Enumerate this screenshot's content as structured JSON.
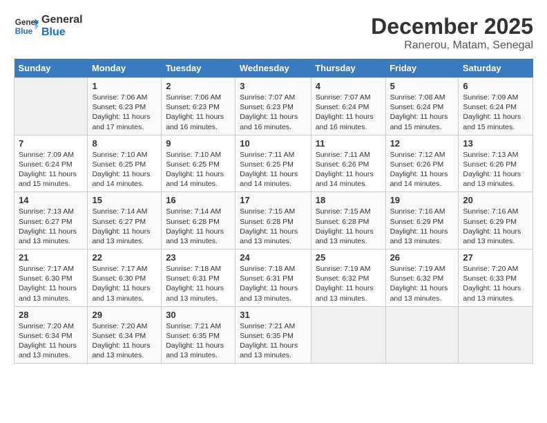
{
  "logo": {
    "text_general": "General",
    "text_blue": "Blue"
  },
  "title": "December 2025",
  "subtitle": "Ranerou, Matam, Senegal",
  "days_of_week": [
    "Sunday",
    "Monday",
    "Tuesday",
    "Wednesday",
    "Thursday",
    "Friday",
    "Saturday"
  ],
  "weeks": [
    [
      {
        "num": "",
        "info": ""
      },
      {
        "num": "1",
        "info": "Sunrise: 7:06 AM\nSunset: 6:23 PM\nDaylight: 11 hours\nand 17 minutes."
      },
      {
        "num": "2",
        "info": "Sunrise: 7:06 AM\nSunset: 6:23 PM\nDaylight: 11 hours\nand 16 minutes."
      },
      {
        "num": "3",
        "info": "Sunrise: 7:07 AM\nSunset: 6:23 PM\nDaylight: 11 hours\nand 16 minutes."
      },
      {
        "num": "4",
        "info": "Sunrise: 7:07 AM\nSunset: 6:24 PM\nDaylight: 11 hours\nand 16 minutes."
      },
      {
        "num": "5",
        "info": "Sunrise: 7:08 AM\nSunset: 6:24 PM\nDaylight: 11 hours\nand 15 minutes."
      },
      {
        "num": "6",
        "info": "Sunrise: 7:09 AM\nSunset: 6:24 PM\nDaylight: 11 hours\nand 15 minutes."
      }
    ],
    [
      {
        "num": "7",
        "info": "Sunrise: 7:09 AM\nSunset: 6:24 PM\nDaylight: 11 hours\nand 15 minutes."
      },
      {
        "num": "8",
        "info": "Sunrise: 7:10 AM\nSunset: 6:25 PM\nDaylight: 11 hours\nand 14 minutes."
      },
      {
        "num": "9",
        "info": "Sunrise: 7:10 AM\nSunset: 6:25 PM\nDaylight: 11 hours\nand 14 minutes."
      },
      {
        "num": "10",
        "info": "Sunrise: 7:11 AM\nSunset: 6:25 PM\nDaylight: 11 hours\nand 14 minutes."
      },
      {
        "num": "11",
        "info": "Sunrise: 7:11 AM\nSunset: 6:26 PM\nDaylight: 11 hours\nand 14 minutes."
      },
      {
        "num": "12",
        "info": "Sunrise: 7:12 AM\nSunset: 6:26 PM\nDaylight: 11 hours\nand 14 minutes."
      },
      {
        "num": "13",
        "info": "Sunrise: 7:13 AM\nSunset: 6:26 PM\nDaylight: 11 hours\nand 13 minutes."
      }
    ],
    [
      {
        "num": "14",
        "info": "Sunrise: 7:13 AM\nSunset: 6:27 PM\nDaylight: 11 hours\nand 13 minutes."
      },
      {
        "num": "15",
        "info": "Sunrise: 7:14 AM\nSunset: 6:27 PM\nDaylight: 11 hours\nand 13 minutes."
      },
      {
        "num": "16",
        "info": "Sunrise: 7:14 AM\nSunset: 6:28 PM\nDaylight: 11 hours\nand 13 minutes."
      },
      {
        "num": "17",
        "info": "Sunrise: 7:15 AM\nSunset: 6:28 PM\nDaylight: 11 hours\nand 13 minutes."
      },
      {
        "num": "18",
        "info": "Sunrise: 7:15 AM\nSunset: 6:28 PM\nDaylight: 11 hours\nand 13 minutes."
      },
      {
        "num": "19",
        "info": "Sunrise: 7:16 AM\nSunset: 6:29 PM\nDaylight: 11 hours\nand 13 minutes."
      },
      {
        "num": "20",
        "info": "Sunrise: 7:16 AM\nSunset: 6:29 PM\nDaylight: 11 hours\nand 13 minutes."
      }
    ],
    [
      {
        "num": "21",
        "info": "Sunrise: 7:17 AM\nSunset: 6:30 PM\nDaylight: 11 hours\nand 13 minutes."
      },
      {
        "num": "22",
        "info": "Sunrise: 7:17 AM\nSunset: 6:30 PM\nDaylight: 11 hours\nand 13 minutes."
      },
      {
        "num": "23",
        "info": "Sunrise: 7:18 AM\nSunset: 6:31 PM\nDaylight: 11 hours\nand 13 minutes."
      },
      {
        "num": "24",
        "info": "Sunrise: 7:18 AM\nSunset: 6:31 PM\nDaylight: 11 hours\nand 13 minutes."
      },
      {
        "num": "25",
        "info": "Sunrise: 7:19 AM\nSunset: 6:32 PM\nDaylight: 11 hours\nand 13 minutes."
      },
      {
        "num": "26",
        "info": "Sunrise: 7:19 AM\nSunset: 6:32 PM\nDaylight: 11 hours\nand 13 minutes."
      },
      {
        "num": "27",
        "info": "Sunrise: 7:20 AM\nSunset: 6:33 PM\nDaylight: 11 hours\nand 13 minutes."
      }
    ],
    [
      {
        "num": "28",
        "info": "Sunrise: 7:20 AM\nSunset: 6:34 PM\nDaylight: 11 hours\nand 13 minutes."
      },
      {
        "num": "29",
        "info": "Sunrise: 7:20 AM\nSunset: 6:34 PM\nDaylight: 11 hours\nand 13 minutes."
      },
      {
        "num": "30",
        "info": "Sunrise: 7:21 AM\nSunset: 6:35 PM\nDaylight: 11 hours\nand 13 minutes."
      },
      {
        "num": "31",
        "info": "Sunrise: 7:21 AM\nSunset: 6:35 PM\nDaylight: 11 hours\nand 13 minutes."
      },
      {
        "num": "",
        "info": ""
      },
      {
        "num": "",
        "info": ""
      },
      {
        "num": "",
        "info": ""
      }
    ]
  ]
}
